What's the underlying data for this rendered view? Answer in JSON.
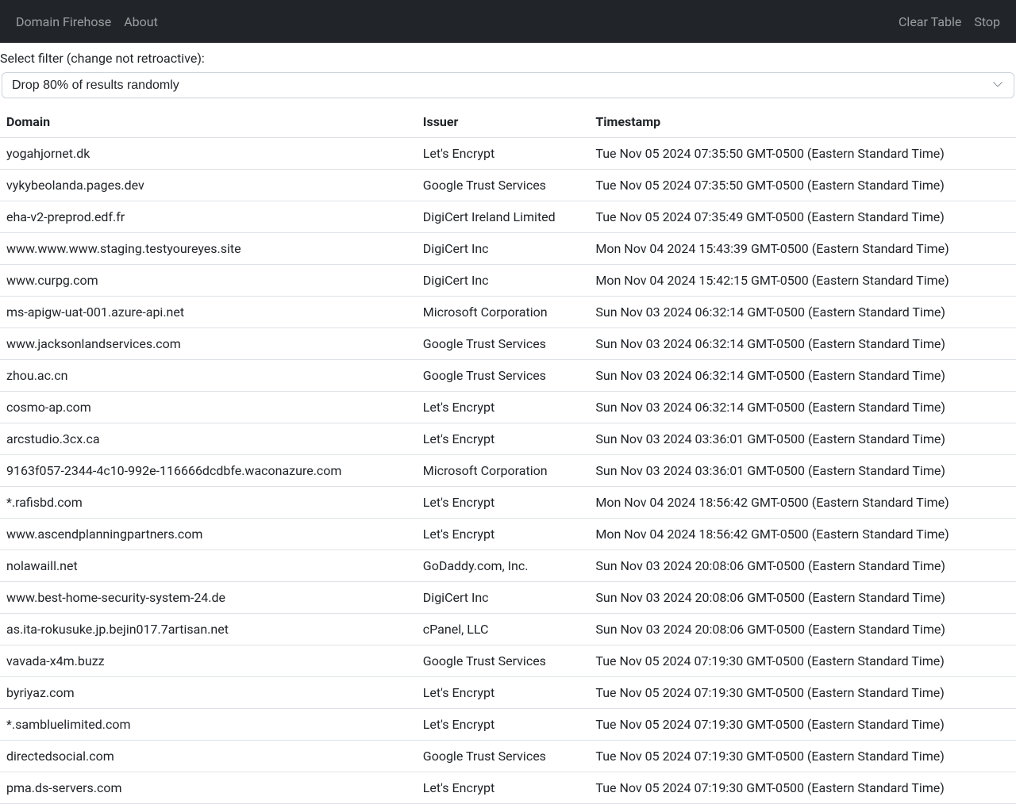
{
  "navbar": {
    "left": [
      {
        "label": "Domain Firehose"
      },
      {
        "label": "About"
      }
    ],
    "right": [
      {
        "label": "Clear Table"
      },
      {
        "label": "Stop"
      }
    ]
  },
  "filter": {
    "label": "Select filter (change not retroactive):",
    "selected": "Drop 80% of results randomly"
  },
  "table": {
    "headers": [
      "Domain",
      "Issuer",
      "Timestamp"
    ],
    "rows": [
      {
        "domain": "yogahjornet.dk",
        "issuer": "Let's Encrypt",
        "timestamp": "Tue Nov 05 2024 07:35:50 GMT-0500 (Eastern Standard Time)"
      },
      {
        "domain": "vykybeolanda.pages.dev",
        "issuer": "Google Trust Services",
        "timestamp": "Tue Nov 05 2024 07:35:50 GMT-0500 (Eastern Standard Time)"
      },
      {
        "domain": "eha-v2-preprod.edf.fr",
        "issuer": "DigiCert Ireland Limited",
        "timestamp": "Tue Nov 05 2024 07:35:49 GMT-0500 (Eastern Standard Time)"
      },
      {
        "domain": "www.www.www.staging.testyoureyes.site",
        "issuer": "DigiCert Inc",
        "timestamp": "Mon Nov 04 2024 15:43:39 GMT-0500 (Eastern Standard Time)"
      },
      {
        "domain": "www.curpg.com",
        "issuer": "DigiCert Inc",
        "timestamp": "Mon Nov 04 2024 15:42:15 GMT-0500 (Eastern Standard Time)"
      },
      {
        "domain": "ms-apigw-uat-001.azure-api.net",
        "issuer": "Microsoft Corporation",
        "timestamp": "Sun Nov 03 2024 06:32:14 GMT-0500 (Eastern Standard Time)"
      },
      {
        "domain": "www.jacksonlandservices.com",
        "issuer": "Google Trust Services",
        "timestamp": "Sun Nov 03 2024 06:32:14 GMT-0500 (Eastern Standard Time)"
      },
      {
        "domain": "zhou.ac.cn",
        "issuer": "Google Trust Services",
        "timestamp": "Sun Nov 03 2024 06:32:14 GMT-0500 (Eastern Standard Time)"
      },
      {
        "domain": "cosmo-ap.com",
        "issuer": "Let's Encrypt",
        "timestamp": "Sun Nov 03 2024 06:32:14 GMT-0500 (Eastern Standard Time)"
      },
      {
        "domain": "arcstudio.3cx.ca",
        "issuer": "Let's Encrypt",
        "timestamp": "Sun Nov 03 2024 03:36:01 GMT-0500 (Eastern Standard Time)"
      },
      {
        "domain": "9163f057-2344-4c10-992e-116666dcdbfe.waconazure.com",
        "issuer": "Microsoft Corporation",
        "timestamp": "Sun Nov 03 2024 03:36:01 GMT-0500 (Eastern Standard Time)"
      },
      {
        "domain": "*.rafisbd.com",
        "issuer": "Let's Encrypt",
        "timestamp": "Mon Nov 04 2024 18:56:42 GMT-0500 (Eastern Standard Time)"
      },
      {
        "domain": "www.ascendplanningpartners.com",
        "issuer": "Let's Encrypt",
        "timestamp": "Mon Nov 04 2024 18:56:42 GMT-0500 (Eastern Standard Time)"
      },
      {
        "domain": "nolawaill.net",
        "issuer": "GoDaddy.com, Inc.",
        "timestamp": "Sun Nov 03 2024 20:08:06 GMT-0500 (Eastern Standard Time)"
      },
      {
        "domain": "www.best-home-security-system-24.de",
        "issuer": "DigiCert Inc",
        "timestamp": "Sun Nov 03 2024 20:08:06 GMT-0500 (Eastern Standard Time)"
      },
      {
        "domain": "as.ita-rokusuke.jp.bejin017.7artisan.net",
        "issuer": "cPanel, LLC",
        "timestamp": "Sun Nov 03 2024 20:08:06 GMT-0500 (Eastern Standard Time)"
      },
      {
        "domain": "vavada-x4m.buzz",
        "issuer": "Google Trust Services",
        "timestamp": "Tue Nov 05 2024 07:19:30 GMT-0500 (Eastern Standard Time)"
      },
      {
        "domain": "byriyaz.com",
        "issuer": "Let's Encrypt",
        "timestamp": "Tue Nov 05 2024 07:19:30 GMT-0500 (Eastern Standard Time)"
      },
      {
        "domain": "*.sambluelimited.com",
        "issuer": "Let's Encrypt",
        "timestamp": "Tue Nov 05 2024 07:19:30 GMT-0500 (Eastern Standard Time)"
      },
      {
        "domain": "directedsocial.com",
        "issuer": "Google Trust Services",
        "timestamp": "Tue Nov 05 2024 07:19:30 GMT-0500 (Eastern Standard Time)"
      },
      {
        "domain": "pma.ds-servers.com",
        "issuer": "Let's Encrypt",
        "timestamp": "Tue Nov 05 2024 07:19:30 GMT-0500 (Eastern Standard Time)"
      }
    ]
  }
}
